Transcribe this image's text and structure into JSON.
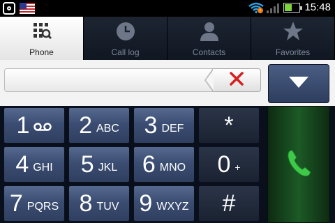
{
  "status_bar": {
    "time": "15:48",
    "icons": [
      "instagram-icon",
      "us-flag-icon",
      "wifi-icon",
      "alert-icon",
      "signal-icon",
      "battery-icon"
    ]
  },
  "tabs": [
    {
      "label": "Phone",
      "icon": "dialpad-icon",
      "active": true
    },
    {
      "label": "Call log",
      "icon": "clock-icon",
      "active": false
    },
    {
      "label": "Contacts",
      "icon": "person-icon",
      "active": false
    },
    {
      "label": "Favorites",
      "icon": "star-icon",
      "active": false
    }
  ],
  "dialer": {
    "number": "",
    "clear_icon": "clear-x-icon",
    "dropdown_icon": "triangle-down-icon"
  },
  "keys": [
    {
      "digit": "1",
      "letters": "",
      "icon": "voicemail-icon"
    },
    {
      "digit": "2",
      "letters": "ABC"
    },
    {
      "digit": "3",
      "letters": "DEF"
    },
    {
      "digit": "*",
      "letters": ""
    },
    {
      "digit": "4",
      "letters": "GHI"
    },
    {
      "digit": "5",
      "letters": "JKL"
    },
    {
      "digit": "6",
      "letters": "MNO"
    },
    {
      "digit": "0",
      "letters": "+"
    },
    {
      "digit": "7",
      "letters": "PQRS"
    },
    {
      "digit": "8",
      "letters": "TUV"
    },
    {
      "digit": "9",
      "letters": "WXYZ"
    },
    {
      "digit": "#",
      "letters": ""
    }
  ],
  "colors": {
    "accent_red": "#d62020",
    "call_green": "#3ec94a",
    "key_blue": "#3b4d72"
  }
}
